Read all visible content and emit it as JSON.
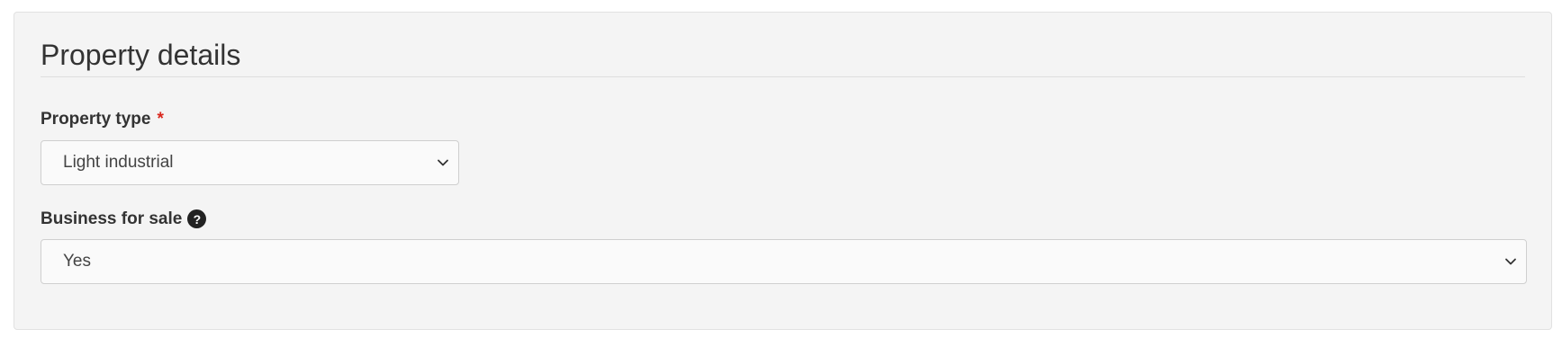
{
  "section": {
    "title": "Property details"
  },
  "fields": {
    "property_type": {
      "label": "Property type",
      "required_mark": "*",
      "selected": "Light industrial"
    },
    "business_for_sale": {
      "label": "Business for sale",
      "help_icon_glyph": "?",
      "selected": "Yes"
    }
  },
  "icons": {
    "help": "question-circle-icon",
    "dropdown": "chevron-down-icon"
  },
  "colors": {
    "panel_background": "#f4f4f4",
    "required": "#d9261c",
    "help_icon_background": "#222222"
  }
}
